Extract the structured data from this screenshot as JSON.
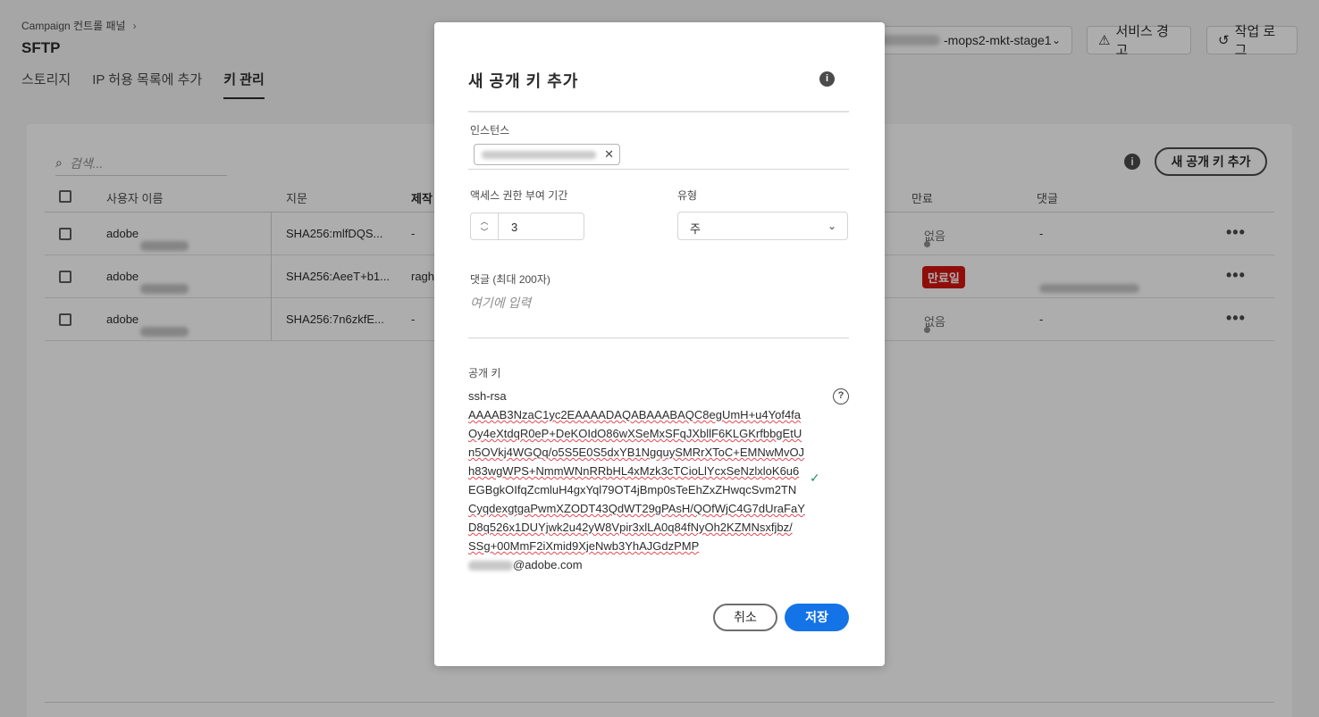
{
  "header": {
    "breadcrumb": "Campaign 컨트롤 패널",
    "title": "SFTP",
    "tabs": [
      {
        "label": "스토리지",
        "active": false
      },
      {
        "label": "IP 허용 목록에 추가",
        "active": false
      },
      {
        "label": "키 관리",
        "active": true
      }
    ],
    "environment_suffix": "-mops2-mkt-stage1",
    "service_alert_label": "서비스 경고",
    "job_log_label": "작업 로그"
  },
  "panel": {
    "search_placeholder": "검색...",
    "add_key_label": "새 공개 키 추가",
    "columns": [
      "사용자 이름",
      "지문",
      "제작",
      "만료",
      "댓글"
    ],
    "rows": [
      {
        "username": "adobe",
        "fingerprint": "SHA256:mlfDQS...",
        "creator": "-",
        "expiry": "없음",
        "expired": false,
        "comment": "-"
      },
      {
        "username": "adobe",
        "fingerprint": "SHA256:AeeT+b1...",
        "creator": "ragh",
        "expiry": "만료일",
        "expired": true,
        "comment": ""
      },
      {
        "username": "adobe",
        "fingerprint": "SHA256:7n6zkfE...",
        "creator": "-",
        "expiry": "없음",
        "expired": false,
        "comment": "-"
      }
    ]
  },
  "modal": {
    "title": "새 공개 키 추가",
    "instance_label": "인스턴스",
    "duration_label": "액세스 권한 부여 기간",
    "duration_value": "3",
    "type_label": "유형",
    "type_value": "주",
    "comment_label": "댓글 (최대 200자)",
    "comment_placeholder": "여기에 입력",
    "public_key_label": "공개 키",
    "public_key_lines": [
      "ssh-rsa",
      "AAAAB3NzaC1yc2EAAAADAQABAAABAQC8egUmH+u4Yof4fa",
      "Oy4eXtdqR0eP+DeKOIdO86wXSeMxSFqJXbllF6KLGKrfbbgEtU",
      "n5OVkj4WGQq/o5S5E0S5dxYB1NgquySMRrXToC+EMNwMvOJ",
      "h83wgWPS+NmmWNnRRbHL4xMzk3cTCioLlYcxSeNzlxloK6u6",
      "EGBgkOIfqZcmluH4gxYql79OT4jBmp0sTeEhZxZHwqcSvm2TN",
      "CyqdexgtgaPwmXZODT43QdWT29gPAsH/QOfWjC4G7dUraFaY",
      "D8q526x1DUYjwk2u42yW8Vpir3xlLA0q84fNyOh2KZMNsxfjbz/",
      "SSg+00MmF2iXmid9XjeNwb3YhAJGdzPMP"
    ],
    "public_key_email_suffix": "@adobe.com",
    "cancel_label": "취소",
    "save_label": "저장"
  }
}
